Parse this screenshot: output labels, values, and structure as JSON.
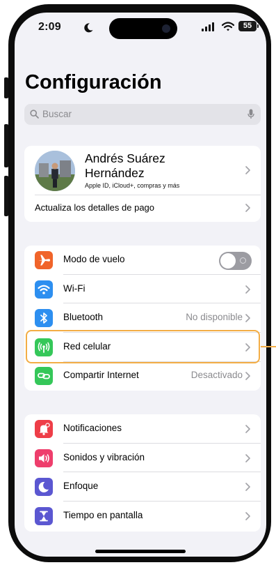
{
  "status_bar": {
    "time": "2:09",
    "battery": "55"
  },
  "page_title": "Configuración",
  "search": {
    "placeholder": "Buscar"
  },
  "profile": {
    "name": "Andrés Suárez Hernández",
    "subtitle": "Apple ID, iCloud+, compras y más",
    "payment_prompt": "Actualiza los detalles de pago"
  },
  "connectivity": [
    {
      "label": "Modo de vuelo",
      "icon": "airplane-icon",
      "color": "#f0642a",
      "toggle": false
    },
    {
      "label": "Wi-Fi",
      "icon": "wifi-icon",
      "color": "#2d8ff0"
    },
    {
      "label": "Bluetooth",
      "icon": "bluetooth-icon",
      "color": "#2d8ff0",
      "value": "No disponible"
    },
    {
      "label": "Red celular",
      "icon": "antenna-icon",
      "color": "#35c759",
      "highlighted": true
    },
    {
      "label": "Compartir Internet",
      "icon": "hotspot-icon",
      "color": "#35c759",
      "value": "Desactivado"
    }
  ],
  "system": [
    {
      "label": "Notificaciones",
      "icon": "bell-icon",
      "color": "#ee3e48"
    },
    {
      "label": "Sonidos y vibración",
      "icon": "speaker-icon",
      "color": "#ee3e6c"
    },
    {
      "label": "Enfoque",
      "icon": "moon-icon",
      "color": "#5b57d1"
    },
    {
      "label": "Tiempo en pantalla",
      "icon": "hourglass-icon",
      "color": "#5b57d1"
    }
  ],
  "colors": {
    "accent_highlight": "#f3ad45",
    "background": "#f2f2f7",
    "toggle_off": "#9c9ca2"
  }
}
